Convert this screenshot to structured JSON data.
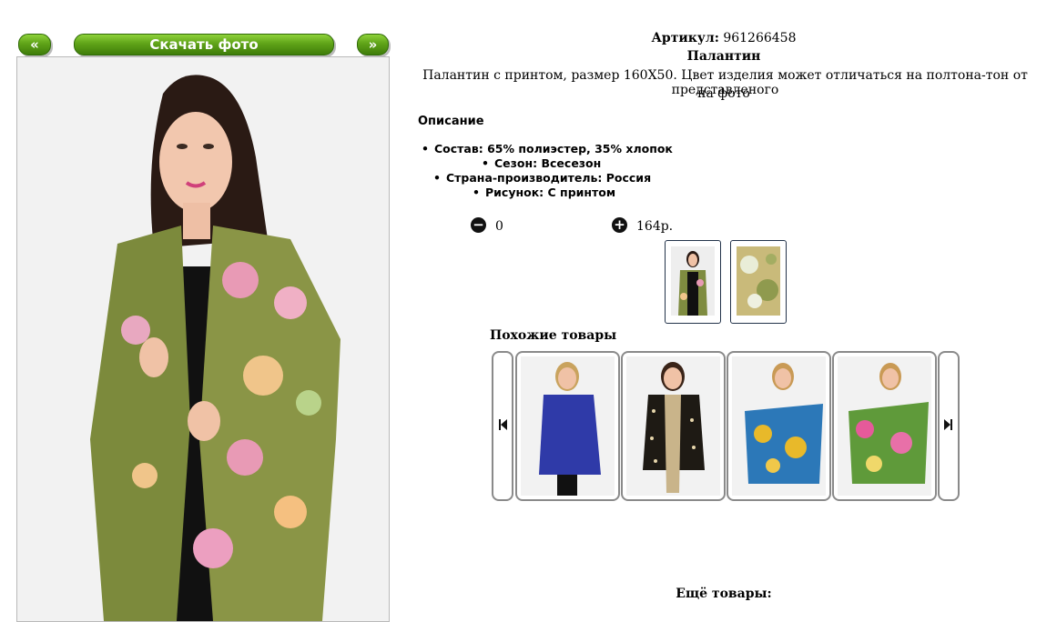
{
  "nav": {
    "prev_label": "«",
    "download_label": "Скачать фото",
    "next_label": "»"
  },
  "product": {
    "article_label": "Артикул:",
    "article_value": "961266458",
    "name": "Палантин",
    "description_line1": "Палантин с принтом, размер 160X50. Цвет изделия может отличаться на полтона-тон от представленого",
    "description_line2": "на фото",
    "section_title": "Описание",
    "specs": [
      "Состав: 65% полиэстер, 35% хлопок",
      "Сезон: Всесезон",
      "Страна-производитель: Россия",
      "Рисунок: С принтом"
    ],
    "quantity": "0",
    "price": "164р."
  },
  "similar": {
    "title": "Похожие товары"
  },
  "more": {
    "title": "Ещё товары:"
  },
  "colors": {
    "accent": "#5fa318",
    "border": "#8a8a8a",
    "thumb_border": "#23334a"
  }
}
